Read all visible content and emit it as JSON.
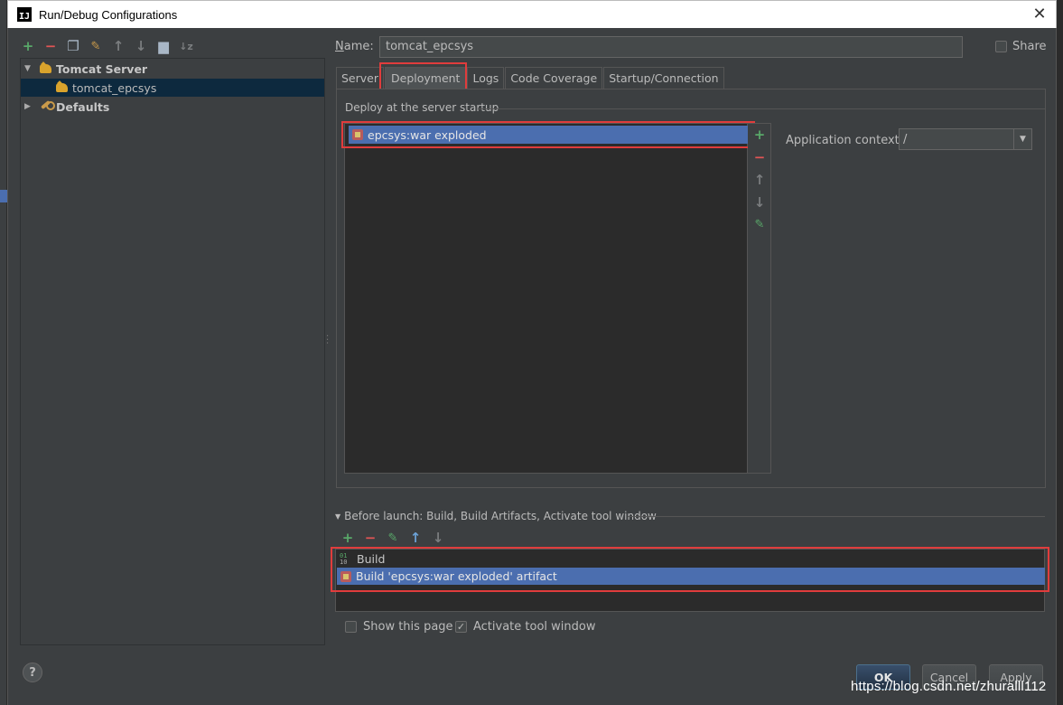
{
  "window": {
    "title": "Run/Debug Configurations",
    "app_icon_text": "IJ"
  },
  "left_toolbar": [
    "add",
    "remove",
    "copy",
    "edit-defaults",
    "move-up",
    "move-down",
    "folder",
    "sort"
  ],
  "tree": {
    "items": [
      {
        "label": "Tomcat Server",
        "expanded": true,
        "bold": true
      },
      {
        "label": "tomcat_epcsys",
        "selected": true
      },
      {
        "label": "Defaults",
        "expanded": false,
        "bold": true
      }
    ]
  },
  "name_field": {
    "label_prefix": "N",
    "label_rest": "ame:",
    "value": "tomcat_epcsys"
  },
  "share": {
    "label": "Share",
    "checked": false
  },
  "tabs": [
    {
      "label": "Server",
      "active": false
    },
    {
      "label": "Deployment",
      "active": true
    },
    {
      "label": "Logs",
      "active": false
    },
    {
      "label": "Code Coverage",
      "active": false
    },
    {
      "label": "Startup/Connection",
      "active": false
    }
  ],
  "deployment": {
    "section_title": "Deploy at the server startup",
    "artifacts": [
      "epcsys:war exploded"
    ],
    "app_context_label": "Application context:",
    "app_context_value": "/"
  },
  "before_launch": {
    "title": "Before launch: Build, Build Artifacts, Activate tool window",
    "tasks": [
      "Build",
      "Build 'epcsys:war exploded' artifact"
    ]
  },
  "options": {
    "show_page": {
      "label": "Show this page",
      "checked": false
    },
    "activate_tool": {
      "label": "Activate tool window",
      "checked": true
    }
  },
  "help_label": "?",
  "buttons": {
    "ok": "OK",
    "cancel": "Cancel",
    "apply": "Apply"
  },
  "watermark": "https://blog.csdn.net/zhuralll112",
  "colors": {
    "background": "#3c3f41",
    "selection": "#4b6eaf",
    "highlight_box": "#e03c3c",
    "add_green": "#59a869",
    "remove_red": "#e05555"
  }
}
